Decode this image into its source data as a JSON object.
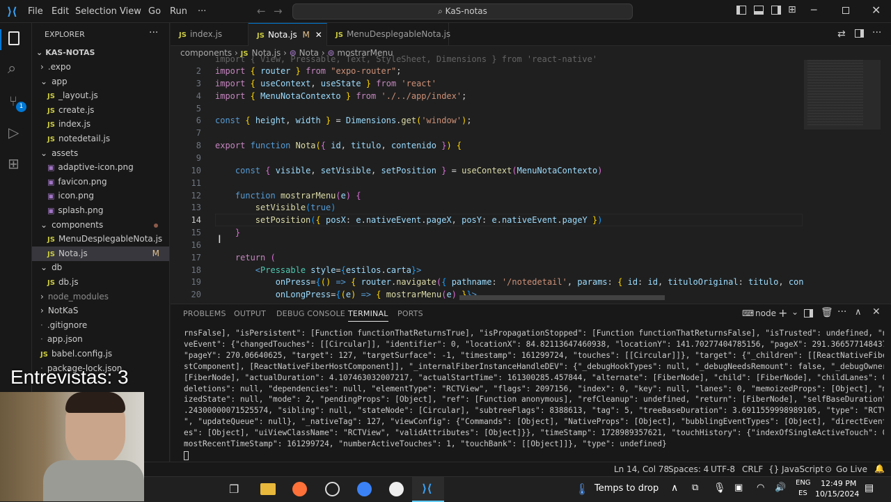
{
  "titlebar": {
    "menus": [
      "File",
      "Edit",
      "Selection",
      "View",
      "Go",
      "Run",
      "···"
    ],
    "search": "KaS-notas"
  },
  "sidebar": {
    "header": "EXPLORER",
    "root": "KAS-NOTAS",
    "items": [
      {
        "label": ".expo",
        "kind": "folder-collapsed",
        "depth": 1
      },
      {
        "label": "app",
        "kind": "folder-open",
        "depth": 1
      },
      {
        "label": "_layout.js",
        "kind": "js",
        "depth": 2
      },
      {
        "label": "create.js",
        "kind": "js",
        "depth": 2
      },
      {
        "label": "index.js",
        "kind": "js",
        "depth": 2
      },
      {
        "label": "notedetail.js",
        "kind": "js",
        "depth": 2
      },
      {
        "label": "assets",
        "kind": "folder-open",
        "depth": 1
      },
      {
        "label": "adaptive-icon.png",
        "kind": "img",
        "depth": 2
      },
      {
        "label": "favicon.png",
        "kind": "img",
        "depth": 2
      },
      {
        "label": "icon.png",
        "kind": "img",
        "depth": 2
      },
      {
        "label": "splash.png",
        "kind": "img",
        "depth": 2
      },
      {
        "label": "components",
        "kind": "folder-open",
        "depth": 1,
        "modified": true
      },
      {
        "label": "MenuDesplegableNota.js",
        "kind": "js",
        "depth": 2
      },
      {
        "label": "Nota.js",
        "kind": "js",
        "depth": 2,
        "selected": true,
        "badge": "M"
      },
      {
        "label": "db",
        "kind": "folder-open",
        "depth": 1
      },
      {
        "label": "db.js",
        "kind": "js",
        "depth": 2
      },
      {
        "label": "node_modules",
        "kind": "folder-collapsed",
        "depth": 1,
        "dim": true
      },
      {
        "label": "NotKaS",
        "kind": "folder-collapsed",
        "depth": 1
      },
      {
        "label": ".gitignore",
        "kind": "file",
        "depth": 1
      },
      {
        "label": "app.json",
        "kind": "file",
        "depth": 1
      },
      {
        "label": "babel.config.js",
        "kind": "js",
        "depth": 1
      },
      {
        "label": "package-lock.json",
        "kind": "file",
        "depth": 1
      }
    ]
  },
  "tabs": [
    {
      "label": "index.js"
    },
    {
      "label": "Nota.js",
      "badge": "M",
      "active": true
    },
    {
      "label": "MenuDesplegableNota.js"
    }
  ],
  "breadcrumb": [
    "components",
    "Nota.js",
    "Nota",
    "mostrarMenu"
  ],
  "editor": {
    "lines": [
      {
        "n": "2",
        "html": "<span class=k>import</span> <span class=b1>{</span> <span class=v>router</span> <span class=b1>}</span> <span class=k>from</span> <span class=s>\"expo-router\"</span>;"
      },
      {
        "n": "3",
        "html": "<span class=k>import</span> <span class=b1>{</span> <span class=v>useContext</span>, <span class=v>useState</span> <span class=b1>}</span> <span class=k>from</span> <span class=s>'react'</span>"
      },
      {
        "n": "4",
        "html": "<span class=k>import</span> <span class=b1>{</span> <span class=v>MenuNotaContexto</span> <span class=b1>}</span> <span class=k>from</span> <span class=s>'./../app/index'</span>;"
      },
      {
        "n": "5",
        "html": ""
      },
      {
        "n": "6",
        "html": "<span class=kw>const</span> <span class=b1>{</span> <span class=v>height</span>, <span class=v>width</span> <span class=b1>}</span> = <span class=v>Dimensions</span>.<span class=f>get</span><span class=b1>(</span><span class=s>'window'</span><span class=b1>)</span>;"
      },
      {
        "n": "7",
        "html": ""
      },
      {
        "n": "8",
        "html": "<span class=k>export</span> <span class=kw>function</span> <span class=f>Nota</span><span class=b1>(</span><span class=b2>{</span> <span class=v>id</span>, <span class=v>titulo</span>, <span class=v>contenido</span> <span class=b2>}</span><span class=b1>)</span> <span class=b1>{</span>"
      },
      {
        "n": "9",
        "html": ""
      },
      {
        "n": "10",
        "html": "    <span class=kw>const</span> <span class=b2>{</span> <span class=v>visible</span>, <span class=v>setVisible</span>, <span class=v>setPosition</span> <span class=b2>}</span> = <span class=f>useContext</span><span class=b2>(</span><span class=v>MenuNotaContexto</span><span class=b2>)</span>"
      },
      {
        "n": "11",
        "html": ""
      },
      {
        "n": "12",
        "html": "    <span class=kw>function</span> <span class=f>mostrarMenu</span><span class=b2>(</span><span class=v>e</span><span class=b2>)</span> <span class=b2>{</span>"
      },
      {
        "n": "13",
        "html": "        <span class=f>setVisible</span><span class=b3>(</span><span class=kw>true</span><span class=b3>)</span>"
      },
      {
        "n": "14",
        "html": "        <span class=f>setPosition</span><span class=b3>(</span><span class=b1>{</span> <span class=v>posX</span>: <span class=v>e</span>.<span class=v>nativeEvent</span>.<span class=v>pageX</span>, <span class=v>posY</span>: <span class=v>e</span>.<span class=v>nativeEvent</span>.<span class=v>pageY</span> <span class=b1>}</span><span class=b3>)</span>",
        "current": true
      },
      {
        "n": "15",
        "html": "    <span class=b2>}</span>"
      },
      {
        "n": "16",
        "html": ""
      },
      {
        "n": "17",
        "html": "    <span class=k>return</span> <span class=b2>(</span>"
      },
      {
        "n": "18",
        "html": "        <span class=kw>&lt;</span><span class=t>Pressable</span> <span class=v>style</span>=<span class=b3>{</span><span class=v>estilos</span>.<span class=v>carta</span><span class=b3>}</span><span class=kw>&gt;</span>"
      },
      {
        "n": "19",
        "html": "            <span class=v>onPress</span>=<span class=b3>{</span><span class=b1>()</span> <span class=kw>=&gt;</span> <span class=b1>{</span> <span class=v>router</span>.<span class=f>navigate</span><span class=b2>(</span><span class=b3>{</span> <span class=v>pathname</span>: <span class=s>'/notedetail'</span>, <span class=v>params</span>: <span class=b1>{</span> <span class=v>id</span>: <span class=v>id</span>, <span class=v>tituloOriginal</span>: <span class=v>titulo</span>, <span class=v>con</span>"
      },
      {
        "n": "20",
        "html": "            <span class=v>onLongPress</span>=<span class=b3>{</span><span class=b1>(</span><span class=v>e</span><span class=b1>)</span> <span class=kw>=&gt;</span> <span class=b1>{</span> <span class=f>mostrarMenu</span><span class=b2>(</span><span class=v>e</span><span class=b2>)</span> <span class=b1>}</span><span class=b3>}</span><span class=kw>&gt;</span>"
      }
    ],
    "partial_line": "import { View, Pressable, Text, StyleSheet, Dimensions } from 'react-native'"
  },
  "panel": {
    "tabs": [
      "PROBLEMS",
      "OUTPUT",
      "DEBUG CONSOLE",
      "TERMINAL",
      "PORTS"
    ],
    "active": "TERMINAL",
    "terminal_name": "node",
    "terminal_lines": [
      "rnsFalse], \"isPersistent\": [Function functionThatReturnsTrue], \"isPropagationStopped\": [Function functionThatReturnsFalse], \"isTrusted\": undefined, \"nati",
      "veEvent\": {\"changedTouches\": [[Circular]], \"identifier\": 0, \"locationX\": 84.82113647460938, \"locationY\": 141.70277404785156, \"pageX\": 291.3665771484375,",
      "\"pageY\": 270.06640625, \"target\": 127, \"targetSurface\": -1, \"timestamp\": 161299724, \"touches\": [[Circular]]}, \"target\": {\"_children\": [[ReactNativeFiberH",
      "stComponent], [ReactNativeFiberHostComponent]], \"_internalFiberInstanceHandleDEV\": {\"_debugHookTypes\": null, \"_debugNeedsRemount\": false, \"_debugOwner\":",
      "[FiberNode], \"actualDuration\": 4.107463032007217, \"actualStartTime\": 161300285.457844, \"alternate\": [FiberNode], \"child\": [FiberNode], \"childLanes\": 0,",
      "deletions\": null, \"dependencies\": null, \"elementType\": \"RCTView\", \"flags\": 2097156, \"index\": 0, \"key\": null, \"lanes\": 0, \"memoizedProps\": [Object], \"memo",
      "izedState\": null, \"mode\": 2, \"pendingProps\": [Object], \"ref\": [Function anonymous], \"refCleanup\": undefined, \"return\": [FiberNode], \"selfBaseDuration\": 0",
      ".24300000071525574, \"sibling\": null, \"stateNode\": [Circular], \"subtreeFlags\": 8388613, \"tag\": 5, \"treeBaseDuration\": 3.6911559998989105, \"type\": \"RCTView",
      "\", \"updateQueue\": null}, \"_nativeTag\": 127, \"viewConfig\": {\"Commands\": [Object], \"NativeProps\": [Object], \"bubblingEventTypes\": [Object], \"directEventTyp",
      "es\": [Object], \"uiViewClassName\": \"RCTView\", \"validAttributes\": [Object]}}, \"timeStamp\": 1728989357621, \"touchHistory\": {\"indexOfSingleActiveTouch\": 0, \"",
      "mostRecentTimeStamp\": 161299724, \"numberActiveTouches\": 1, \"touchBank\": [[Object]]}, \"type\": undefined}"
    ]
  },
  "statusbar": {
    "position": "Ln 14, Col 78",
    "spaces": "Spaces: 4",
    "encoding": "UTF-8",
    "eol": "CRLF",
    "language": "JavaScript",
    "golive": "Go Live"
  },
  "taskbar": {
    "weather": "Temps to drop",
    "lang1": "ENG",
    "lang2": "ES",
    "time": "12:49 PM",
    "date": "10/15/2024"
  },
  "overlay": {
    "text": "Entrevistas: 3"
  }
}
